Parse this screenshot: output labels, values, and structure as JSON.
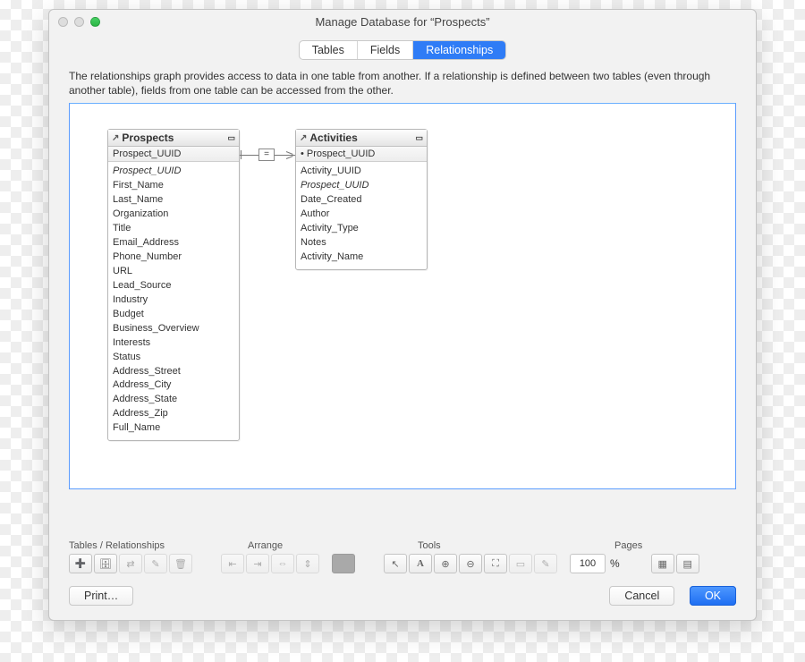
{
  "window": {
    "title": "Manage Database for “Prospects”"
  },
  "tabs": {
    "items": [
      "Tables",
      "Fields",
      "Relationships"
    ],
    "active": "Relationships"
  },
  "description": "The relationships graph provides access to data in one table from another. If a relationship is defined between two tables (even through another table), fields from one table can be accessed from the other.",
  "graph": {
    "tables": [
      {
        "name": "Prospects",
        "key": "Prospect_UUID",
        "fields": [
          {
            "label": "Prospect_UUID",
            "italic": true
          },
          {
            "label": "First_Name"
          },
          {
            "label": "Last_Name"
          },
          {
            "label": "Organization"
          },
          {
            "label": "Title"
          },
          {
            "label": "Email_Address"
          },
          {
            "label": "Phone_Number"
          },
          {
            "label": "URL"
          },
          {
            "label": "Lead_Source"
          },
          {
            "label": "Industry"
          },
          {
            "label": "Budget"
          },
          {
            "label": "Business_Overview"
          },
          {
            "label": "Interests"
          },
          {
            "label": "Status"
          },
          {
            "label": "Address_Street"
          },
          {
            "label": "Address_City"
          },
          {
            "label": "Address_State"
          },
          {
            "label": "Address_Zip"
          },
          {
            "label": "Full_Name"
          }
        ]
      },
      {
        "name": "Activities",
        "key": "Prospect_UUID",
        "fields": [
          {
            "label": "Activity_UUID"
          },
          {
            "label": "Prospect_UUID",
            "italic": true
          },
          {
            "label": "Date_Created"
          },
          {
            "label": "Author"
          },
          {
            "label": "Activity_Type"
          },
          {
            "label": "Notes"
          },
          {
            "label": "Activity_Name"
          }
        ]
      }
    ],
    "relationship": {
      "operator": "="
    }
  },
  "toolbar": {
    "groups": {
      "tables": "Tables / Relationships",
      "arrange": "Arrange",
      "tools": "Tools",
      "pages": "Pages"
    },
    "zoom": {
      "value": "100",
      "suffix": "%"
    }
  },
  "footer": {
    "print": "Print…",
    "cancel": "Cancel",
    "ok": "OK"
  }
}
